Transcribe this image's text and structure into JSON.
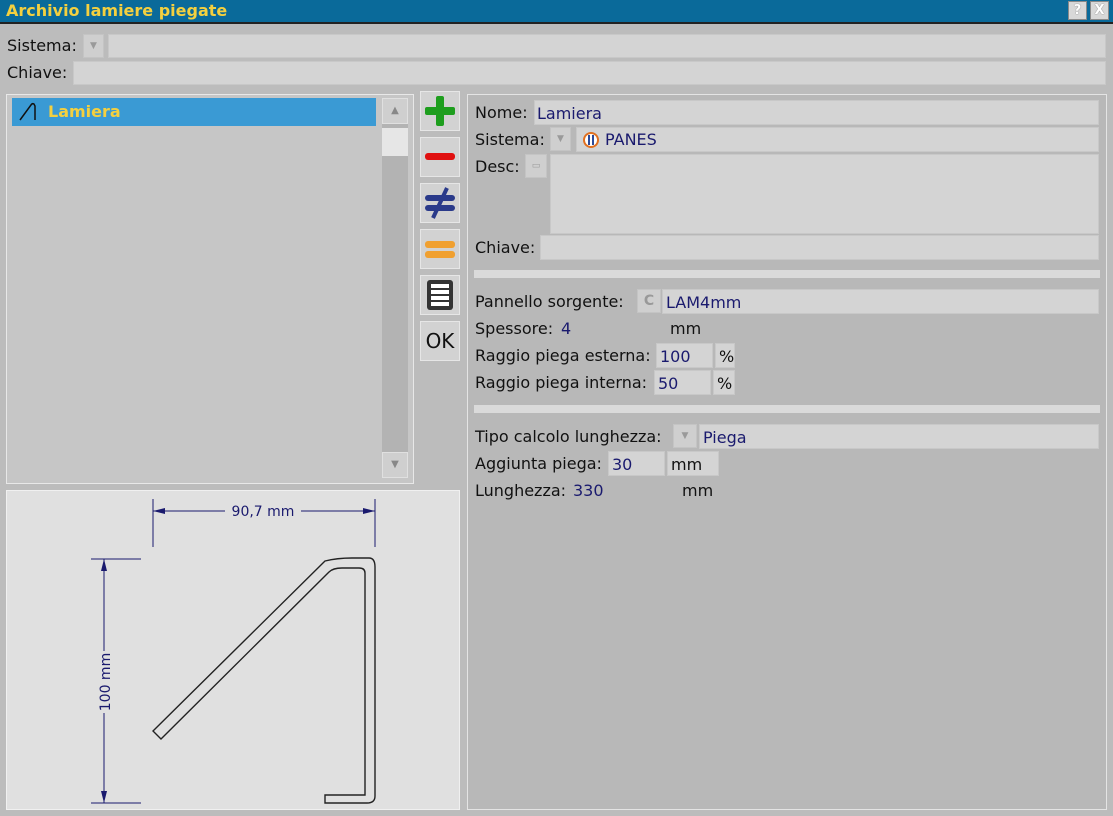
{
  "window": {
    "title": "Archivio lamiere piegate",
    "help_label": "?",
    "close_label": "X"
  },
  "top": {
    "sistema_label": "Sistema:",
    "sistema_value": "",
    "chiave_label": "Chiave:",
    "chiave_value": ""
  },
  "list": {
    "items": [
      {
        "label": "Lamiera",
        "icon": "bent-sheet-icon"
      }
    ],
    "scroll_up_icon": "triangle-up-icon",
    "scroll_down_icon": "triangle-down-icon"
  },
  "actions": {
    "ok_label": "OK",
    "buttons": [
      "add-icon",
      "remove-icon",
      "not-equal-icon",
      "equal-icon",
      "list-icon"
    ]
  },
  "preview": {
    "width_dim": "90,7 mm",
    "height_dim": "100 mm"
  },
  "form": {
    "nome_label": "Nome:",
    "nome_value": "Lamiera",
    "sistema_label": "Sistema:",
    "sistema_value": "PANES",
    "desc_label": "Desc:",
    "desc_value": "",
    "chiave_label": "Chiave:",
    "chiave_value": "",
    "pannello_label": "Pannello sorgente:",
    "pannello_btn": "C",
    "pannello_value": "LAM4mm",
    "spessore_label": "Spessore:",
    "spessore_value": "4",
    "spessore_unit": "mm",
    "raggio_est_label": "Raggio piega esterna:",
    "raggio_est_value": "100",
    "raggio_est_unit": "%",
    "raggio_int_label": "Raggio piega interna:",
    "raggio_int_value": "50",
    "raggio_int_unit": "%",
    "tipo_label": "Tipo calcolo lunghezza:",
    "tipo_value": "Piega",
    "aggiunta_label": "Aggiunta piega:",
    "aggiunta_value": "30",
    "aggiunta_unit": "mm",
    "lunghezza_label": "Lunghezza:",
    "lunghezza_value": "330",
    "lunghezza_unit": "mm"
  },
  "colors": {
    "title_bar": "#0a6a9a",
    "title_text": "#f4d03f",
    "selection": "#3a9ad4",
    "value_text": "#1a1a6e",
    "add_green": "#1e9e1e",
    "remove_red": "#e01010",
    "equal_orange": "#f0a030",
    "notequal_blue": "#2a3a8a"
  }
}
